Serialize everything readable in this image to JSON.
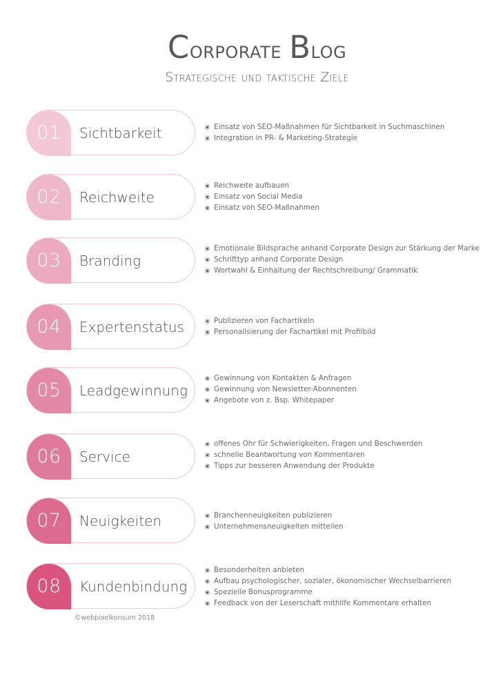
{
  "header": {
    "title_first_letter_1": "C",
    "title_rest_1": "orporate",
    "title_first_letter_2": "B",
    "title_rest_2": "log",
    "subtitle": "Strategische und taktische Ziele"
  },
  "colors": {
    "card_border": "#f0c7d3",
    "badges": [
      "#f3c7d5",
      "#efb7ca",
      "#ebaabf",
      "#e799b2",
      "#e388a6",
      "#e07a9b",
      "#dd6a8f",
      "#da557e"
    ]
  },
  "goals": [
    {
      "number": "01",
      "label": "Sichtbarkeit",
      "bullets": [
        "Einsatz von SEO-Maßnahmen für Sichtbarkeit in Suchmaschinen",
        "Integration in PR- & Marketing-Strategie"
      ]
    },
    {
      "number": "02",
      "label": "Reichweite",
      "bullets": [
        "Reichweite aufbauen",
        "Einsatz von Social Media",
        "Einsatz von SEO-Maßnahmen"
      ]
    },
    {
      "number": "03",
      "label": "Branding",
      "bullets": [
        "Emotionale Bildsprache anhand Corporate Design zur Stärkung der Marke",
        "Schrifttyp anhand Corporate Design",
        "Wortwahl & Einhaltung der Rechtschreibung/ Grammatik"
      ]
    },
    {
      "number": "04",
      "label": "Expertenstatus",
      "bullets": [
        "Publizieren von Fachartikeln",
        "Personalisierung der Fachartikel mit Profilbild"
      ]
    },
    {
      "number": "05",
      "label": "Leadgewinnung",
      "bullets": [
        "Gewinnung von Kontakten & Anfragen",
        "Gewinnung von Newsletter-Abonnenten",
        "Angebote von z. Bsp. Whitepaper"
      ]
    },
    {
      "number": "06",
      "label": "Service",
      "bullets": [
        "offenes Ohr für Schwierigkeiten, Fragen und Beschwerden",
        "schnelle Beantwortung von Kommentaren",
        "Tipps zur besseren Anwendung der Produkte"
      ]
    },
    {
      "number": "07",
      "label": "Neuigkeiten",
      "bullets": [
        "Branchenneuigkeiten publizieren",
        "Unternehmensneuigkeiten mitteilen"
      ]
    },
    {
      "number": "08",
      "label": "Kundenbindung",
      "bullets": [
        "Besonderheiten anbieten",
        "Aufbau psychologischer, sozialer, ökonomischer Wechselbarrieren",
        "Spezielle Bonusprogramme",
        "Feedback von der Leserschaft mithilfe Kommentare erhalten"
      ]
    }
  ],
  "footer": {
    "copyright": "©webpixelkonsum 2018"
  }
}
